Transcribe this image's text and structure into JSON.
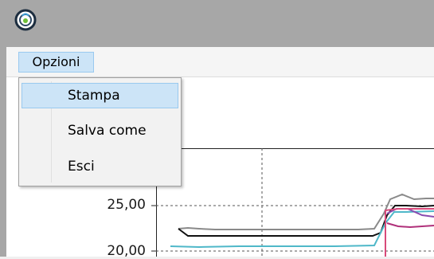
{
  "menubar": {
    "opzioni_label": "Opzioni"
  },
  "menu_items": [
    {
      "label": "Stampa",
      "highlighted": true
    },
    {
      "label": "Salva come",
      "highlighted": false
    },
    {
      "label": "Esci",
      "highlighted": false
    }
  ],
  "chart": {
    "tick_labels": [
      "25,00",
      "20,00"
    ]
  },
  "colors": {
    "accent": "#cce4f7",
    "accent_border": "#99c9ef",
    "title_bar": "#a7a7a7"
  },
  "icons": {
    "app": "app-logo-icon"
  }
}
